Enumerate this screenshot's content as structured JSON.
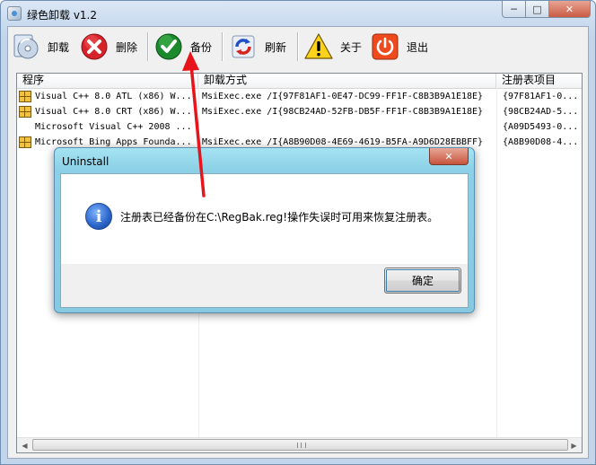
{
  "window": {
    "title": "绿色卸载 v1.2",
    "controls": {
      "minimize": "─",
      "maximize": "□",
      "close": "✕"
    }
  },
  "toolbar": {
    "items": [
      {
        "label": "卸载",
        "icon": "uninstall-cd-icon"
      },
      {
        "label": "删除",
        "icon": "delete-x-icon"
      },
      {
        "label": "备份",
        "icon": "backup-check-icon"
      },
      {
        "label": "刷新",
        "icon": "refresh-icon"
      },
      {
        "label": "关于",
        "icon": "warning-icon"
      },
      {
        "label": "退出",
        "icon": "power-icon"
      }
    ]
  },
  "list": {
    "columns": [
      "程序",
      "卸载方式",
      "注册表项目"
    ],
    "rows": [
      {
        "program": "Visual C++ 8.0 ATL (x86) W...",
        "uninstall": "MsiExec.exe /I{97F81AF1-0E47-DC99-FF1F-C8B3B9A1E18E}",
        "registry": "{97F81AF1-0..."
      },
      {
        "program": "Visual C++ 8.0 CRT (x86) W...",
        "uninstall": "MsiExec.exe /I{98CB24AD-52FB-DB5F-FF1F-C8B3B9A1E18E}",
        "registry": "{98CB24AD-5..."
      },
      {
        "program": "Microsoft Visual C++ 2008 ...",
        "uninstall": "",
        "registry": "{A09D5493-0..."
      },
      {
        "program": "Microsoft Bing Apps Founda...",
        "uninstall": "MsiExec.exe /I{A8B90D08-4E69-4619-B5FA-A9D6D28EBBFF}",
        "registry": "{A8B90D08-4..."
      }
    ]
  },
  "dialog": {
    "title": "Uninstall",
    "close": "✕",
    "message": "注册表已经备份在C:\\RegBak.reg!操作失误时可用来恢复注册表。",
    "ok_label": "确定",
    "icon": "info-icon"
  },
  "colors": {
    "annotation_arrow": "#e8141b",
    "dialog_frame": "#8bd0e6"
  }
}
